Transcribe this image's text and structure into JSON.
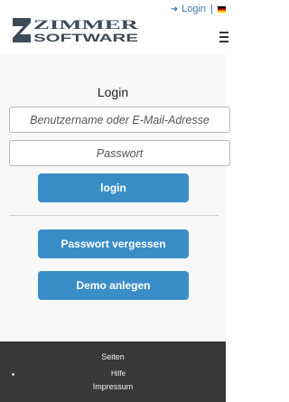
{
  "header": {
    "login_label": "Login",
    "separator": "|",
    "language_flag": "german-flag",
    "logo_text_top": "ZIMMER",
    "logo_text_bottom": "SOFTWARE"
  },
  "login_form": {
    "title": "Login",
    "username_placeholder": "Benutzername oder E-Mail-Adresse",
    "password_placeholder": "Passwort",
    "login_button": "login"
  },
  "actions": {
    "forgot_password_button": "Passwort vergessen",
    "demo_button": "Demo anlegen"
  },
  "footer": {
    "heading": "Seiten",
    "links": [
      "Hilfe",
      "Impressum"
    ]
  },
  "colors": {
    "accent": "#3a8ec8",
    "link": "#3a7ab7",
    "footer_bg": "#383838",
    "logo": "#3e4a57"
  }
}
